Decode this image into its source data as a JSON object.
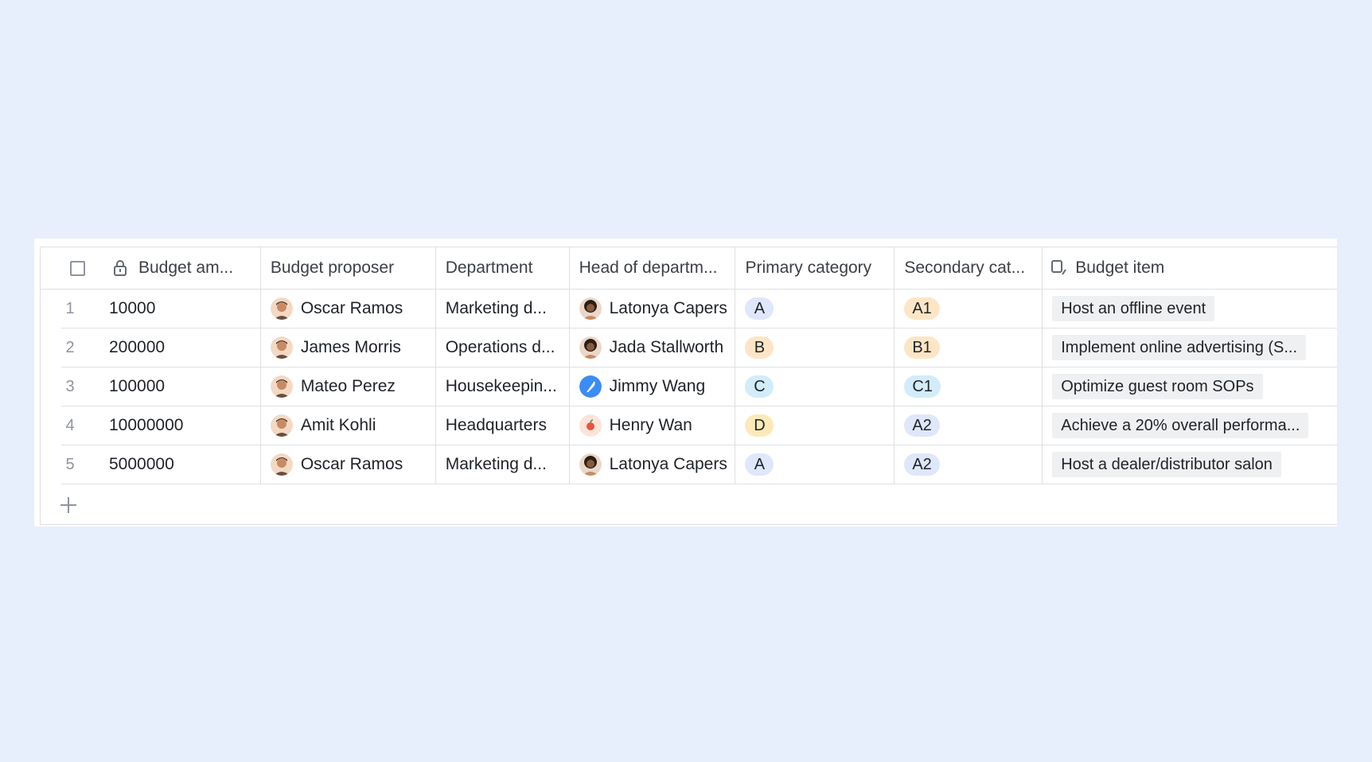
{
  "header": {
    "budget_amount": "Budget am...",
    "budget_proposer": "Budget proposer",
    "department": "Department",
    "head_of_department": "Head of departm...",
    "primary_category": "Primary category",
    "secondary_category": "Secondary cat...",
    "budget_item": "Budget item"
  },
  "colors": {
    "A": "#dfe7fb",
    "B": "#fde6c6",
    "C": "#d3ecf9",
    "D": "#fbeab8",
    "A1": "#fde6c6",
    "B1": "#fde6c6",
    "C1": "#d3ecf9",
    "A2": "#dfe7fb"
  },
  "rows": [
    {
      "num": "1",
      "amount": "10000",
      "proposer": "Oscar Ramos",
      "proposer_avatar": "man-avatar-icon",
      "department": "Marketing d...",
      "head": "Latonya Capers",
      "head_avatar": "woman-avatar-icon",
      "primary": "A",
      "secondary": "A1",
      "item": "Host an offline event"
    },
    {
      "num": "2",
      "amount": "200000",
      "proposer": "James Morris",
      "proposer_avatar": "man-avatar-icon",
      "department": "Operations d...",
      "head": "Jada Stallworth",
      "head_avatar": "woman-avatar-icon",
      "primary": "B",
      "secondary": "B1",
      "item": "Implement online advertising (S..."
    },
    {
      "num": "3",
      "amount": "100000",
      "proposer": "Mateo Perez",
      "proposer_avatar": "man-avatar-icon",
      "department": "Housekeepin...",
      "head": "Jimmy Wang",
      "head_avatar": "feather-avatar-icon",
      "primary": "C",
      "secondary": "C1",
      "item": "Optimize guest room SOPs"
    },
    {
      "num": "4",
      "amount": "10000000",
      "proposer": "Amit Kohli",
      "proposer_avatar": "man-avatar-icon",
      "department": "Headquarters",
      "head": "Henry Wan",
      "head_avatar": "apple-avatar-icon",
      "primary": "D",
      "secondary": "A2",
      "item": "Achieve a 20% overall performa..."
    },
    {
      "num": "5",
      "amount": "5000000",
      "proposer": "Oscar Ramos",
      "proposer_avatar": "man-avatar-icon",
      "department": "Marketing d...",
      "head": "Latonya Capers",
      "head_avatar": "woman-avatar-icon",
      "primary": "A",
      "secondary": "A2",
      "item": "Host a dealer/distributor salon"
    }
  ]
}
